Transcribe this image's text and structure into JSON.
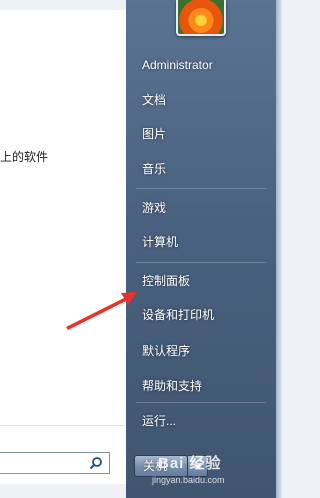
{
  "left_panel": {
    "partial_program_text": "上的软件",
    "search_placeholder": ""
  },
  "user": {
    "name": "Administrator"
  },
  "right_menu": {
    "items": [
      {
        "label": "文档"
      },
      {
        "label": "图片"
      },
      {
        "label": "音乐"
      },
      {
        "label": "游戏"
      },
      {
        "label": "计算机"
      },
      {
        "label": "控制面板"
      },
      {
        "label": "设备和打印机"
      },
      {
        "label": "默认程序"
      },
      {
        "label": "帮助和支持"
      },
      {
        "label": "运行..."
      }
    ]
  },
  "shutdown": {
    "label": "关机"
  },
  "watermark": {
    "text": "Bai 经验",
    "sub": "jingyan.baidu.com"
  },
  "colors": {
    "arrow": "#e8322b",
    "panel": "#4a617f"
  }
}
